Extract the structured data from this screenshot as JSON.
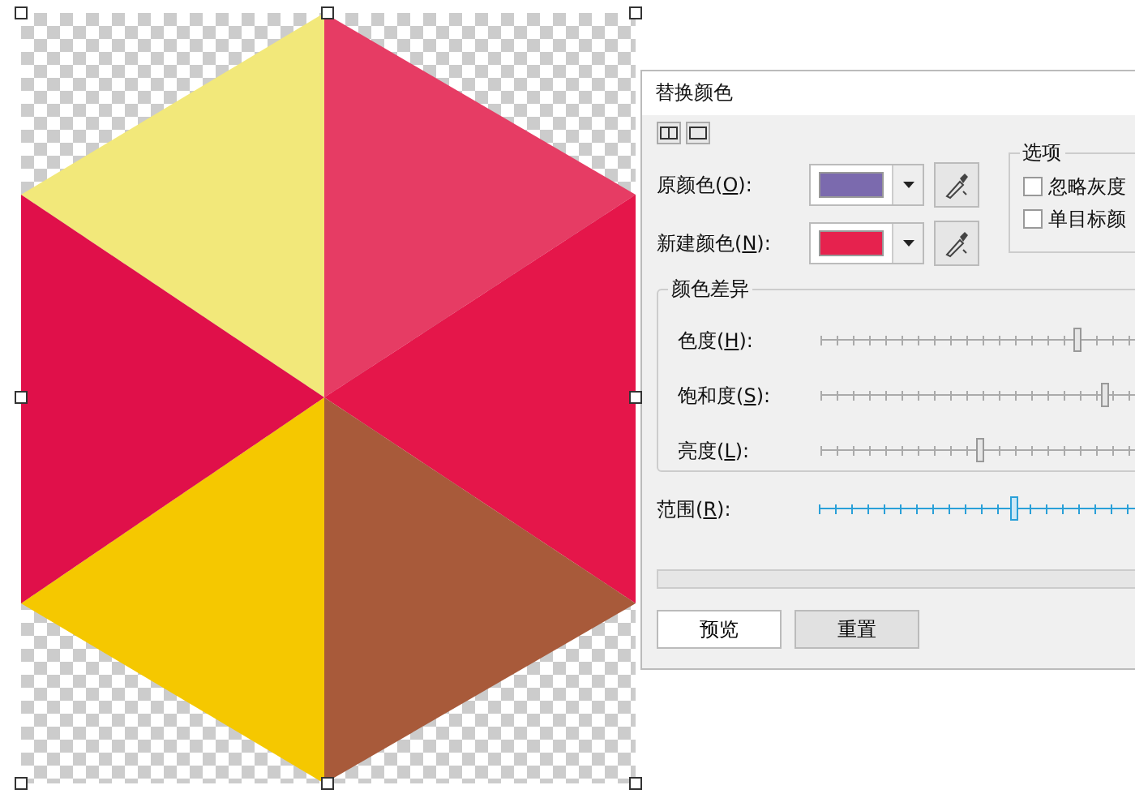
{
  "dialog": {
    "title": "替换颜色",
    "view_buttons": [
      {
        "kind": "split",
        "selected": false
      },
      {
        "kind": "single",
        "selected": false
      }
    ],
    "colors": [
      {
        "prefix": "原颜色(",
        "key": "O",
        "suffix": "):",
        "color": "#7b6aae"
      },
      {
        "prefix": "新建颜色(",
        "key": "N",
        "suffix": "):",
        "color": "#e6224e"
      }
    ],
    "options": {
      "title": "选项",
      "items": [
        {
          "label": "忽略灰度",
          "checked": false
        },
        {
          "label": "单目标颜",
          "checked": false
        }
      ]
    },
    "difference": {
      "title": "颜色差异",
      "sliders": [
        {
          "prefix": "色度(",
          "key": "H",
          "suffix": "):",
          "level": 0.76
        },
        {
          "prefix": "饱和度(",
          "key": "S",
          "suffix": "):",
          "level": 0.84
        },
        {
          "prefix": "亮度(",
          "key": "L",
          "suffix": "):",
          "level": 0.47
        }
      ]
    },
    "range": {
      "prefix": "范围(",
      "key": "R",
      "suffix": "):",
      "level": 0.59
    },
    "progress": {
      "level": 0
    },
    "buttons": [
      "预览",
      "重置"
    ]
  }
}
